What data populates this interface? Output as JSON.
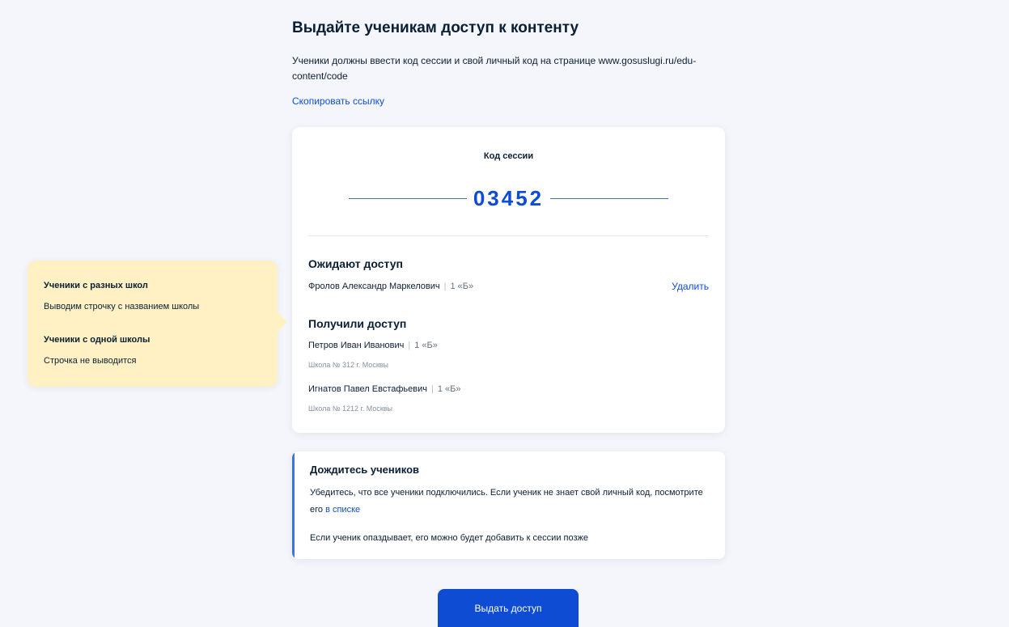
{
  "header": {
    "title": "Выдайте ученикам доступ к контенту",
    "description": "Ученики должны ввести код сессии и свой личный код на странице www.gosuslugi.ru/edu-content/code",
    "copy_link_label": "Скопировать ссылку"
  },
  "session": {
    "label": "Код сессии",
    "code": "03452"
  },
  "waiting": {
    "title": "Ожидают доступ",
    "students": [
      {
        "name": "Фролов Александр Маркелович",
        "class": "1 «Б»"
      }
    ],
    "delete_label": "Удалить"
  },
  "granted": {
    "title": "Получили доступ",
    "students": [
      {
        "name": "Петров Иван Иванович",
        "class": "1 «Б»",
        "school": "Школа № 312 г. Москвы"
      },
      {
        "name": "Игнатов Павел Евстафьевич",
        "class": "1 «Б»",
        "school": "Школа № 1212 г. Москвы"
      }
    ]
  },
  "info": {
    "title": "Дождитесь учеников",
    "text": "Убедитесь, что все ученики подключились. Если ученик не знает свой личный код, посмотрите его",
    "link": "в списке",
    "text2": "Если ученик опаздывает, его можно будет добавить к сессии позже"
  },
  "action": {
    "submit_label": "Выдать доступ"
  },
  "note": {
    "items": [
      {
        "title": "Ученики с разных школ",
        "text": "Выводим строчку с названием школы"
      },
      {
        "title": "Ученики с одной школы",
        "text": "Строчка не выводится"
      }
    ]
  },
  "colors": {
    "accent": "#0d4cd3",
    "background": "#f4f6fb",
    "note_background": "#fff1c4",
    "info_bar": "#3b72e6"
  }
}
